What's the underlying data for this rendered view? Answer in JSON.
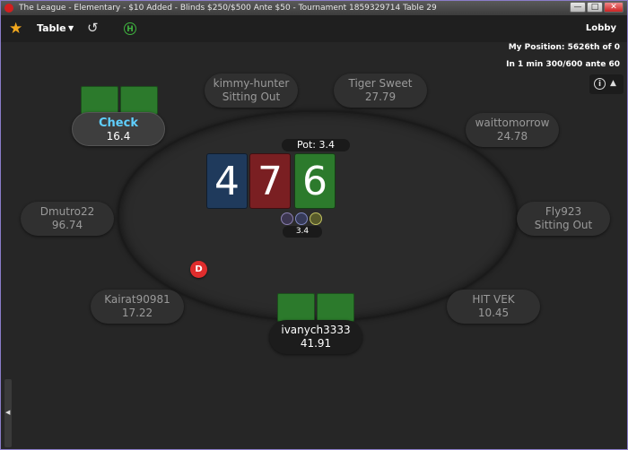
{
  "window": {
    "title": "The League - Elementary - $10 Added - Blinds $250/$500 Ante $50 - Tournament 1859329714 Table 29",
    "buttons": [
      "—",
      "□",
      "✕"
    ]
  },
  "toolbar": {
    "table_label": "Table",
    "lobby_label": "Lobby",
    "h_label": "H",
    "star_icon": "star-icon",
    "undo_icon": "rebuy-icon"
  },
  "info": {
    "position": "My Position: 5626th of 0",
    "blinds_next": "In 1 min 300/600 ante 60"
  },
  "pot": {
    "label": "Pot: 3.4"
  },
  "board": {
    "cards": [
      "4",
      "7",
      "6"
    ]
  },
  "bet": {
    "amount": "3.4"
  },
  "dealer_button": "D",
  "seats": {
    "top_left": {
      "name": "Check",
      "stack": "16.4"
    },
    "top_center_left": {
      "name": "kimmy-hunter",
      "stack": "Sitting Out"
    },
    "top_center_right": {
      "name": "Tiger Sweet",
      "stack": "27.79"
    },
    "top_right": {
      "name": "waittomorrow",
      "stack": "24.78"
    },
    "left": {
      "name": "Dmutro22",
      "stack": "96.74"
    },
    "right": {
      "name": "Fly923",
      "stack": "Sitting Out"
    },
    "bottom_left": {
      "name": "Kairat90981",
      "stack": "17.22"
    },
    "bottom_center": {
      "name": "ivanych3333",
      "stack": "41.91"
    },
    "bottom_right": {
      "name": "HIT VEK",
      "stack": "10.45"
    }
  },
  "colors": {
    "accent": "#f2a81e",
    "card_green": "#2c7a2c",
    "card_red": "#7a1f22",
    "card_blue": "#1f3a5c",
    "dealer": "#e02d2d",
    "action_text": "#5fd0ff"
  }
}
